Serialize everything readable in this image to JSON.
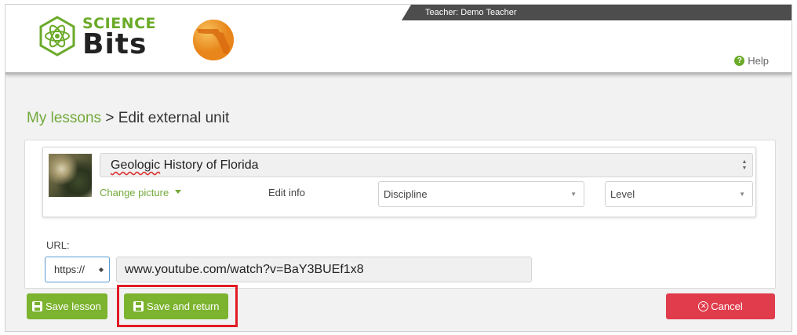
{
  "header": {
    "teacher_label": "Teacher: Demo Teacher",
    "logo_top": "SCIENCE",
    "logo_bottom": "Bits",
    "help_label": "Help",
    "accent_color": "#6aaa28"
  },
  "breadcrumb": {
    "parent": "My lessons",
    "separator": ">",
    "current": "Edit external unit"
  },
  "unit": {
    "title_prefix": "Geologic",
    "title_suffix": " History of Florida",
    "change_picture_label": "Change picture",
    "edit_info_label": "Edit info",
    "discipline_value": "Discipline",
    "level_value": "Level"
  },
  "url": {
    "label": "URL:",
    "protocol": "https://",
    "value": "www.youtube.com/watch?v=BaY3BUEf1x8"
  },
  "buttons": {
    "save_lesson": "Save lesson",
    "save_and_return": "Save and return",
    "cancel": "Cancel",
    "save_color": "#7cb32f",
    "cancel_color": "#e03c4b",
    "highlight_color": "#e01b24"
  }
}
